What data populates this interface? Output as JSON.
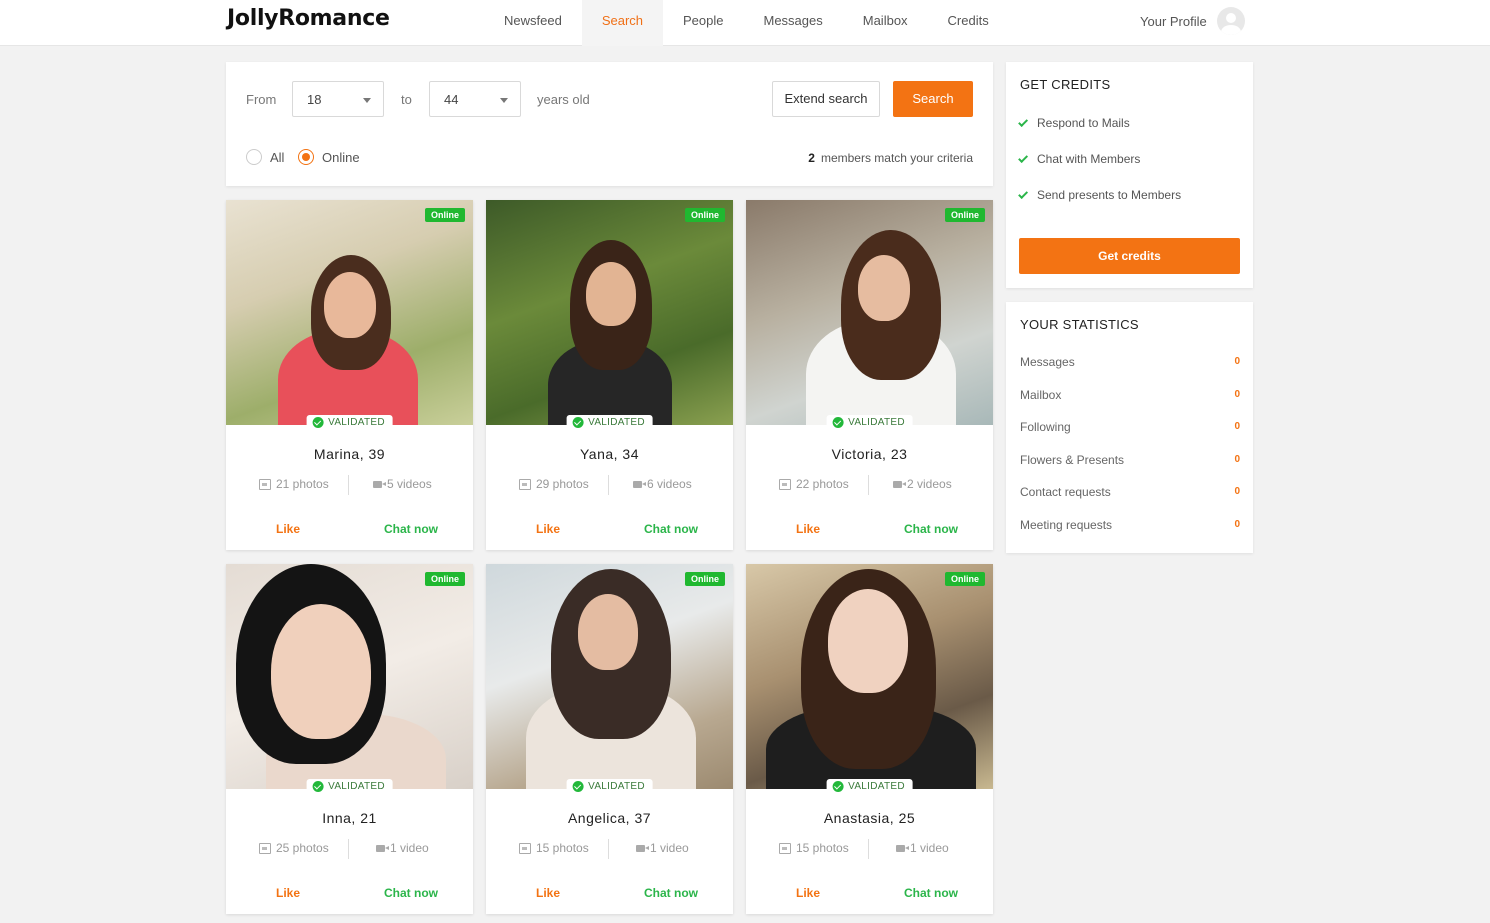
{
  "header": {
    "logo": "JollyRomance",
    "nav": [
      {
        "label": "Newsfeed",
        "active": false
      },
      {
        "label": "Search",
        "active": true
      },
      {
        "label": "People",
        "active": false
      },
      {
        "label": "Messages",
        "active": false
      },
      {
        "label": "Mailbox",
        "active": false
      },
      {
        "label": "Credits",
        "active": false
      }
    ],
    "profile_label": "Your Profile"
  },
  "search": {
    "from_label": "From",
    "from_value": "18",
    "to_label": "to",
    "to_value": "44",
    "suffix": "years old",
    "extend_label": "Extend search",
    "search_label": "Search",
    "radio_all": "All",
    "radio_online": "Online",
    "selected": "Online",
    "match_count": "2",
    "match_text": "members match your criteria"
  },
  "profiles": [
    {
      "name": "Marina, 39",
      "photos": "21 photos",
      "videos": "5 videos",
      "online": "Online",
      "validated": "VALIDATED",
      "like": "Like",
      "chat": "Chat now"
    },
    {
      "name": "Yana, 34",
      "photos": "29 photos",
      "videos": "6 videos",
      "online": "Online",
      "validated": "VALIDATED",
      "like": "Like",
      "chat": "Chat now"
    },
    {
      "name": "Victoria, 23",
      "photos": "22 photos",
      "videos": "2 videos",
      "online": "Online",
      "validated": "VALIDATED",
      "like": "Like",
      "chat": "Chat now"
    },
    {
      "name": "Inna, 21",
      "photos": "25 photos",
      "videos": "1 video",
      "online": "Online",
      "validated": "VALIDATED",
      "like": "Like",
      "chat": "Chat now"
    },
    {
      "name": "Angelica, 37",
      "photos": "15 photos",
      "videos": "1 video",
      "online": "Online",
      "validated": "VALIDATED",
      "like": "Like",
      "chat": "Chat now"
    },
    {
      "name": "Anastasia, 25",
      "photos": "15 photos",
      "videos": "1 video",
      "online": "Online",
      "validated": "VALIDATED",
      "like": "Like",
      "chat": "Chat now"
    }
  ],
  "credits_box": {
    "title": "GET CREDITS",
    "benefits": [
      "Respond to Mails",
      "Chat with Members",
      "Send presents to Members"
    ],
    "button": "Get credits"
  },
  "stats_box": {
    "title": "YOUR STATISTICS",
    "rows": [
      {
        "label": "Messages",
        "value": "0"
      },
      {
        "label": "Mailbox",
        "value": "0"
      },
      {
        "label": "Following",
        "value": "0"
      },
      {
        "label": "Flowers & Presents",
        "value": "0"
      },
      {
        "label": "Contact requests",
        "value": "0"
      },
      {
        "label": "Meeting requests",
        "value": "0"
      }
    ]
  },
  "colors": {
    "accent": "#f37313",
    "online": "#20b830",
    "chat": "#2bb54a"
  }
}
